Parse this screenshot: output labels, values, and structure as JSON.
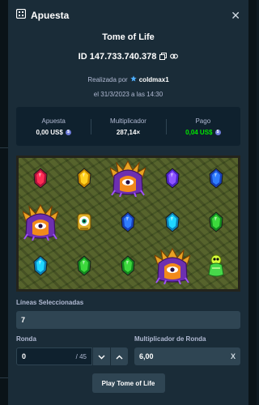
{
  "modal": {
    "title": "Apuesta",
    "game_name": "Tome of Life",
    "bet_id": "ID 147.733.740.378",
    "placed_by_prefix": "Realizada por",
    "username": "coldmax1",
    "date_text": "el 31/3/2023 a las 14:30"
  },
  "stats": {
    "bet_label": "Apuesta",
    "bet_value": "0,00 US$",
    "multiplier_label": "Multiplicador",
    "multiplier_value": "287,14×",
    "payout_label": "Pago",
    "payout_value": "0,04 US$",
    "payout_color": "#00e701",
    "currency_icon": "usd-coin-icon"
  },
  "reels": {
    "rows": [
      [
        "red-gem",
        "yellow-gem",
        "tome-of-life",
        "purple-gem",
        "blue-gem"
      ],
      [
        "tome-of-life",
        "golden-eye",
        "blue-gem",
        "teal-gem",
        "green-gem"
      ],
      [
        "teal-gem",
        "green-gem",
        "green-gem",
        "tome-of-life",
        "green-potion"
      ]
    ]
  },
  "form": {
    "lines_label": "Líneas Seleccionadas",
    "lines_value": "7",
    "round_label": "Ronda",
    "round_value": "0",
    "round_total": "/ 45",
    "round_multiplier_label": "Multiplicador de Ronda",
    "round_multiplier_value": "6,00",
    "round_multiplier_clear": "X"
  },
  "play_button": "Play Tome of Life"
}
